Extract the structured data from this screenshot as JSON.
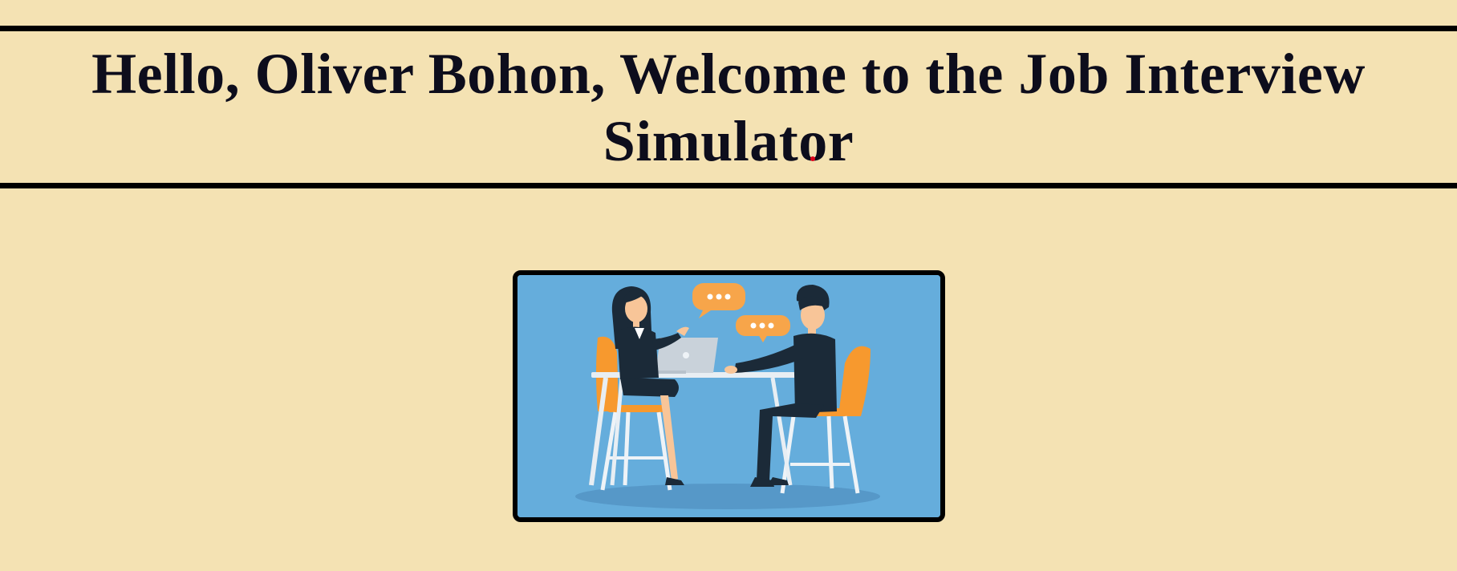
{
  "header": {
    "title": "Hello, Oliver Bohon, Welcome to the Job Interview Simulator"
  },
  "hero": {
    "illustration": "job-interview-illustration",
    "speech_bubble_text": "..."
  },
  "colors": {
    "page_background": "#f4e2b3",
    "title_text": "#0d0d1c",
    "border": "#000000",
    "illustration_background": "#65addc",
    "chair": "#f7992e",
    "speech_bubble": "#f7a54a",
    "suit": "#1b2a38",
    "skin": "#f8c598",
    "table": "#e8eef3"
  }
}
